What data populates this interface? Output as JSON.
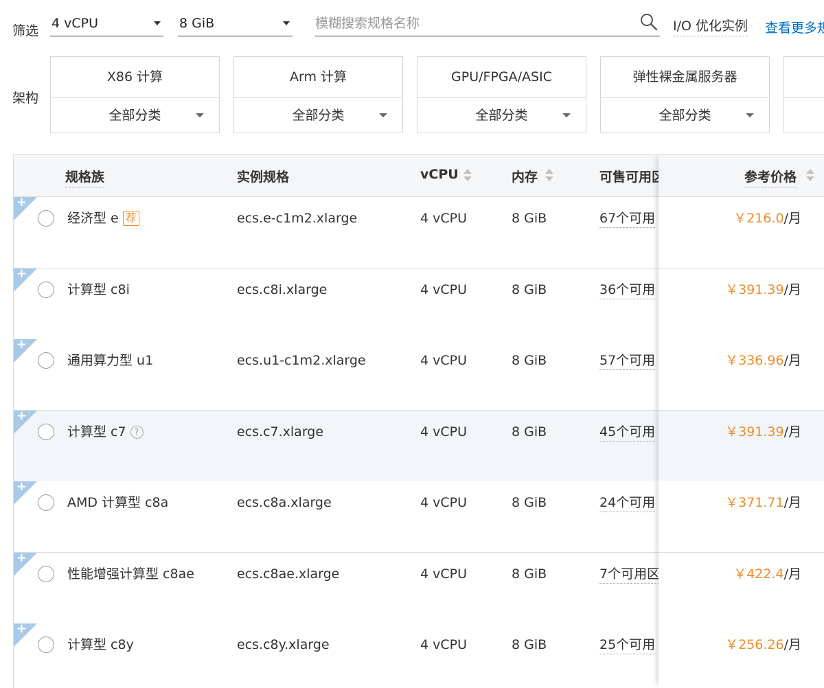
{
  "filters": {
    "label": "筛选",
    "cpu": "4 vCPU",
    "memory": "8 GiB",
    "search_placeholder": "模糊搜索规格名称",
    "io_optimized": "I/O 优化实例",
    "more_link": "查看更多规"
  },
  "architecture": {
    "label": "架构",
    "cards": [
      {
        "name": "X86 计算",
        "category": "全部分类"
      },
      {
        "name": "Arm 计算",
        "category": "全部分类"
      },
      {
        "name": "GPU/FPGA/ASIC",
        "category": "全部分类"
      },
      {
        "name": "弹性裸金属服务器",
        "category": "全部分类"
      }
    ]
  },
  "table": {
    "headers": {
      "family": "规格族",
      "spec": "实例规格",
      "vcpu": "vCPU",
      "memory": "内存",
      "zones": "可售可用区",
      "price": "参考价格"
    },
    "rows": [
      {
        "family": "经济型 e",
        "tag": "荐",
        "spec": "ecs.e-c1m2.xlarge",
        "vcpu": "4 vCPU",
        "memory": "8 GiB",
        "zones": "67个可用",
        "price": "￥216.0",
        "unit": "/月"
      },
      {
        "family": "计算型 c8i",
        "spec": "ecs.c8i.xlarge",
        "vcpu": "4 vCPU",
        "memory": "8 GiB",
        "zones": "36个可用",
        "price": "￥391.39",
        "unit": "/月"
      },
      {
        "family": "通用算力型 u1",
        "spec": "ecs.u1-c1m2.xlarge",
        "vcpu": "4 vCPU",
        "memory": "8 GiB",
        "zones": "57个可用",
        "price": "￥336.96",
        "unit": "/月"
      },
      {
        "family": "计算型 c7",
        "help": "?",
        "spec": "ecs.c7.xlarge",
        "vcpu": "4 vCPU",
        "memory": "8 GiB",
        "zones": "45个可用",
        "price": "￥391.39",
        "unit": "/月"
      },
      {
        "family": "AMD 计算型 c8a",
        "spec": "ecs.c8a.xlarge",
        "vcpu": "4 vCPU",
        "memory": "8 GiB",
        "zones": "24个可用",
        "price": "￥371.71",
        "unit": "/月"
      },
      {
        "family": "性能增强计算型 c8ae",
        "spec": "ecs.c8ae.xlarge",
        "vcpu": "4 vCPU",
        "memory": "8 GiB",
        "zones": "7个可用区",
        "price": "￥422.4",
        "unit": "/月"
      },
      {
        "family": "计算型 c8y",
        "spec": "ecs.c8y.xlarge",
        "vcpu": "4 vCPU",
        "memory": "8 GiB",
        "zones": "25个可用",
        "price": "￥256.26",
        "unit": "/月"
      }
    ]
  },
  "colors": {
    "accent": "#f08c2a",
    "link": "#0070cc",
    "corner": "#a9c9e8"
  },
  "icons": {
    "search": "search-icon",
    "row_expand": "plus-icon",
    "sort": "sort-icon",
    "help": "help-icon"
  }
}
